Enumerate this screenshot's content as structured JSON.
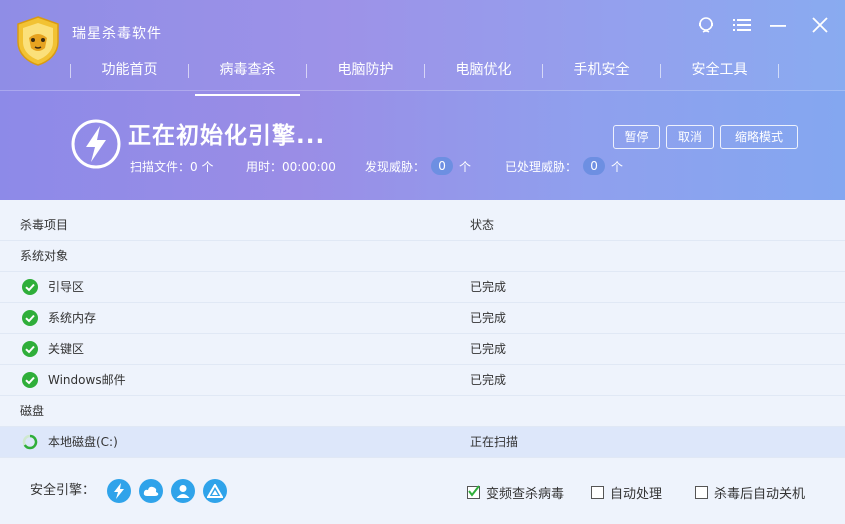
{
  "app": {
    "title": "瑞星杀毒软件"
  },
  "nav": [
    {
      "label": "功能首页",
      "active": false
    },
    {
      "label": "病毒查杀",
      "active": true
    },
    {
      "label": "电脑防护",
      "active": false
    },
    {
      "label": "电脑优化",
      "active": false
    },
    {
      "label": "手机安全",
      "active": false
    },
    {
      "label": "安全工具",
      "active": false
    }
  ],
  "scan": {
    "title": "正在初始化引擎...",
    "files_label": "扫描文件：0 个",
    "time_label": "用时：00:00:00",
    "threats_label": "发现威胁：",
    "threats_value": "0",
    "threats_unit": "个",
    "handled_label": "已处理威胁：",
    "handled_value": "0",
    "handled_unit": "个"
  },
  "buttons": {
    "pause": "暂停",
    "cancel": "取消",
    "mini": "缩略模式"
  },
  "table": {
    "col_item": "杀毒项目",
    "col_status": "状态",
    "groups": [
      {
        "name": "系统对象"
      },
      {
        "name": "磁盘"
      }
    ],
    "rows": [
      {
        "label": "引导区",
        "status": "已完成"
      },
      {
        "label": "系统内存",
        "status": "已完成"
      },
      {
        "label": "关键区",
        "status": "已完成"
      },
      {
        "label": "Windows邮件",
        "status": "已完成"
      },
      {
        "label": "本地磁盘(C:)",
        "status": "正在扫描"
      }
    ]
  },
  "footer": {
    "engine_label": "安全引擎：",
    "engines": [
      "bolt-icon",
      "cloud-icon",
      "user-icon",
      "drive-icon"
    ],
    "options": [
      {
        "label": "变频查杀病毒",
        "checked": true
      },
      {
        "label": "自动处理",
        "checked": false
      },
      {
        "label": "杀毒后自动关机",
        "checked": false
      }
    ]
  },
  "colors": {
    "accent": "#2fa3ea",
    "check_green": "#2fae3a",
    "header_start": "#8d8ae8",
    "header_end": "#84a7f0"
  }
}
